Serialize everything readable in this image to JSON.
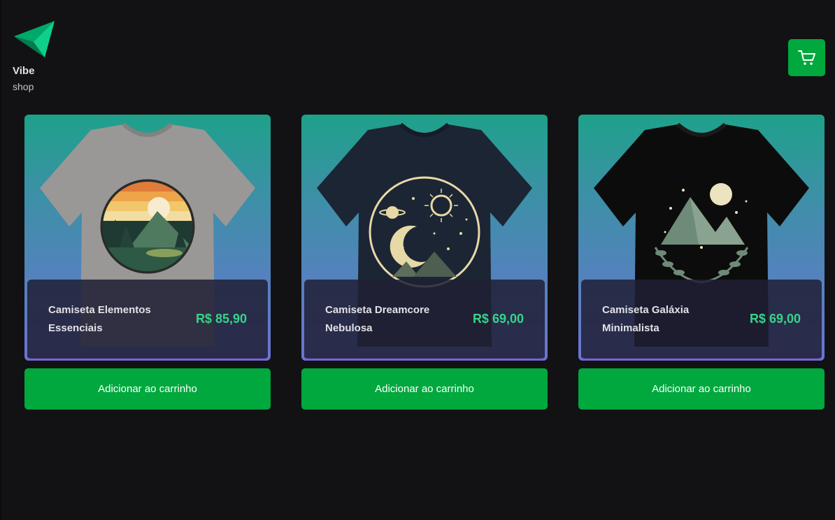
{
  "brand": {
    "name": "Vibe",
    "tagline": "shop",
    "logo_icon": "triangle-logo-icon",
    "accent": "#00a83e"
  },
  "header": {
    "cart_icon": "cart-icon"
  },
  "products": [
    {
      "name": "Camiseta Elementos Essenciais",
      "price": "R$ 85,90",
      "button_label": "Adicionar ao carrinho",
      "shirt_color": "#9a9896"
    },
    {
      "name": "Camiseta Dreamcore Nebulosa",
      "price": "R$ 69,00",
      "button_label": "Adicionar ao carrinho",
      "shirt_color": "#1c2534"
    },
    {
      "name": "Camiseta Galáxia Minimalista",
      "price": "R$ 69,00",
      "button_label": "Adicionar ao carrinho",
      "shirt_color": "#0c0c0c"
    }
  ]
}
